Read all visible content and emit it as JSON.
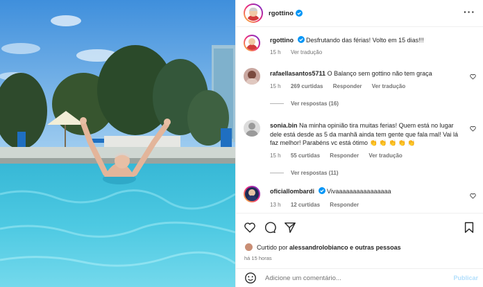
{
  "post": {
    "author": "rgottino",
    "caption": "Desfrutando das férias! Volto em 15 dias!!!",
    "caption_time": "15 h",
    "caption_translate": "Ver tradução"
  },
  "comments": [
    {
      "user": "rafaellasantos5711",
      "text": "O Balanço sem gottino não tem graça",
      "time": "15 h",
      "likes": "269 curtidas",
      "reply": "Responder",
      "translate": "Ver tradução",
      "replies": "Ver respostas (16)"
    },
    {
      "user": "sonia.bin",
      "text": "Na minha opinião tira muitas ferias! Quem está no lugar dele está desde as 5 da manhã ainda tem gente que fala mal! Vai lá faz melhor! Parabéns vc está ótimo 👏 👏 👏 👏 👏",
      "time": "15 h",
      "likes": "55 curtidas",
      "reply": "Responder",
      "translate": "Ver tradução",
      "replies": "Ver respostas (11)"
    },
    {
      "user": "oficiallombardi",
      "text": "Vivaaaaaaaaaaaaaaaa",
      "time": "13 h",
      "likes": "12 curtidas",
      "reply": "Responder"
    }
  ],
  "likes_line": {
    "prefix": "Curtido por",
    "user": "alessandrolobianco",
    "suffix": "e outras pessoas"
  },
  "post_time": "há 15 horas",
  "add_comment": {
    "placeholder": "Adicione um comentário...",
    "publish": "Publicar"
  },
  "icons": {
    "like": "heart-icon",
    "comment": "comment-icon",
    "share": "share-icon",
    "save": "bookmark-icon",
    "emoji": "emoji-icon",
    "more": "more-icon"
  },
  "colors": {
    "verified": "#0095f6",
    "muted": "#737373",
    "publish": "#b2dffc"
  }
}
